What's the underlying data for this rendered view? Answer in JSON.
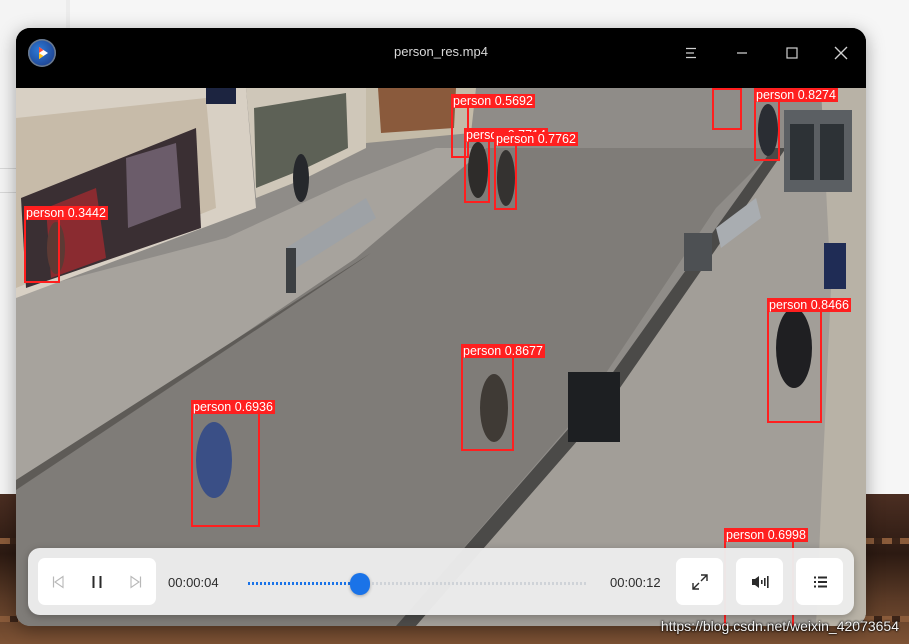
{
  "window": {
    "title": "person_res.mp4"
  },
  "detections": [
    {
      "label": "person 0.5692"
    },
    {
      "label": "person 0.7714"
    },
    {
      "label": "person 0.7762"
    },
    {
      "label": "person 0.8274"
    },
    {
      "label": "person 0.3442"
    },
    {
      "label": "person 0.8466"
    },
    {
      "label": "person 0.8677"
    },
    {
      "label": "person 0.6936"
    },
    {
      "label": "person 0.6998"
    }
  ],
  "playback": {
    "current_time": "00:00:04",
    "total_time": "00:00:12",
    "progress": 0.33,
    "state": "playing"
  },
  "watermark": "https://blog.csdn.net/weixin_42073654",
  "icons": {
    "logo": "player-logo-icon",
    "menu": "menu-icon",
    "minimize": "minimize-icon",
    "maximize": "maximize-icon",
    "close": "close-icon",
    "previous": "previous-track-icon",
    "pause": "pause-icon",
    "next": "next-track-icon",
    "fullscreen": "fullscreen-icon",
    "volume": "volume-icon",
    "playlist": "playlist-icon"
  },
  "colors": {
    "accent": "#1a73e8",
    "detection": "#ff1f1f",
    "titlebar": "#000000"
  }
}
